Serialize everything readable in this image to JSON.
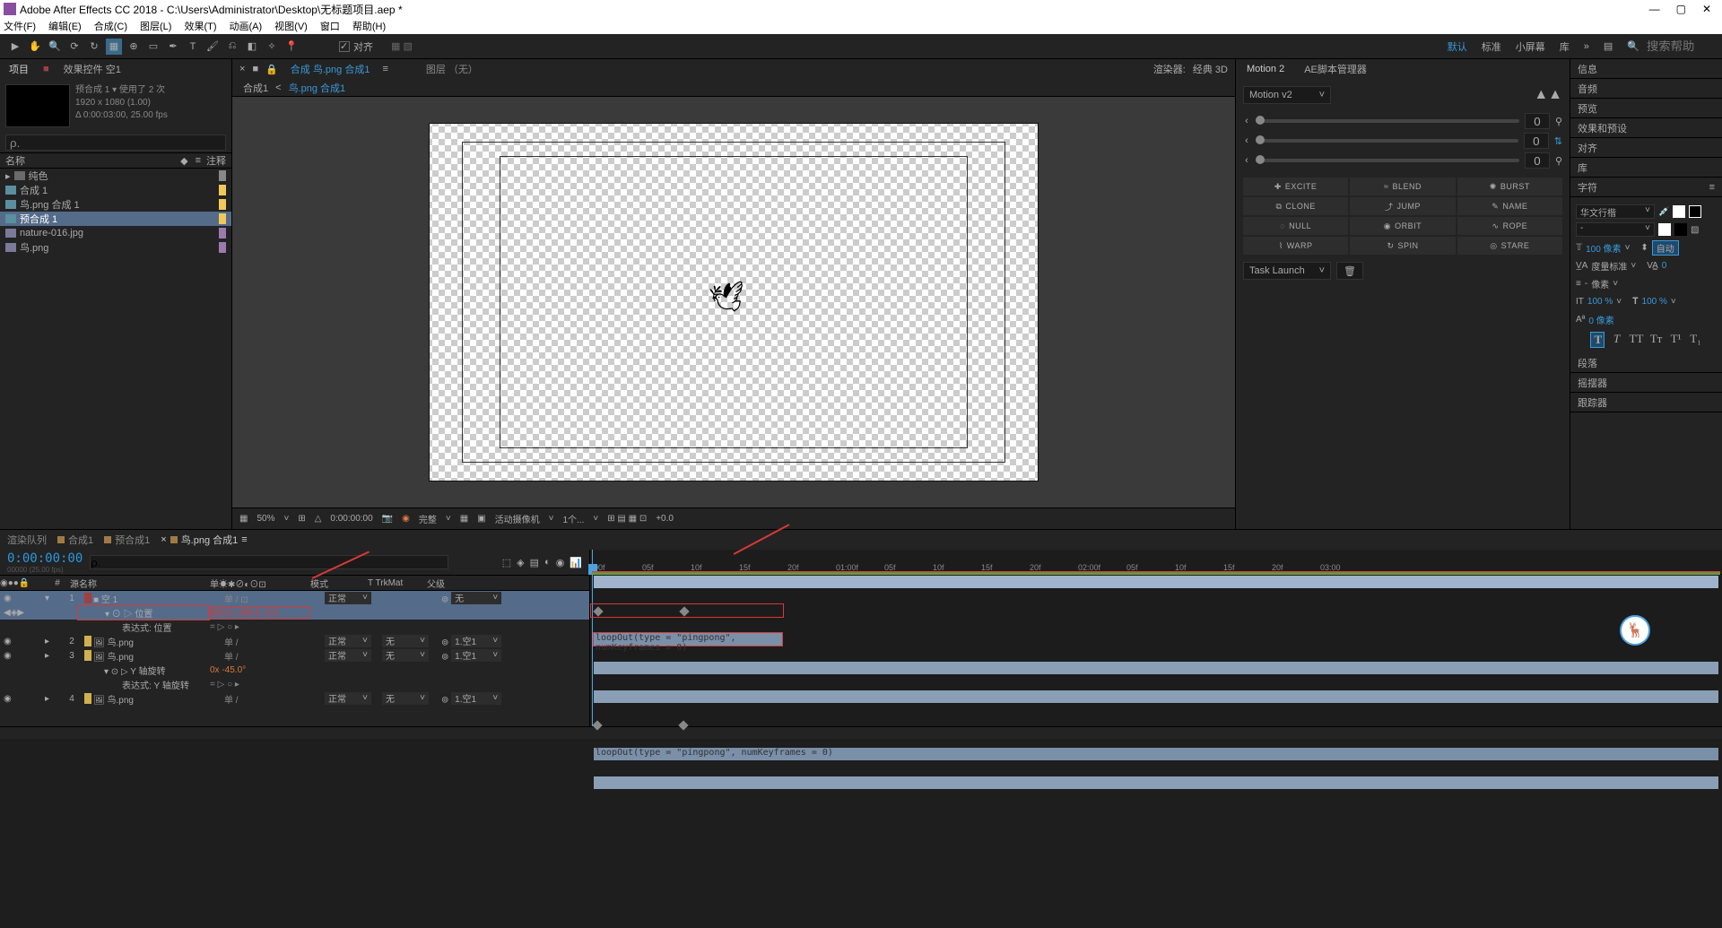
{
  "titlebar": {
    "icon_label": "Ae",
    "title": "Adobe After Effects CC 2018 - C:\\Users\\Administrator\\Desktop\\无标题项目.aep *"
  },
  "menubar": [
    "文件(F)",
    "编辑(E)",
    "合成(C)",
    "图层(L)",
    "效果(T)",
    "动画(A)",
    "视图(V)",
    "窗口",
    "帮助(H)"
  ],
  "toolbar": {
    "snap_label": "对齐",
    "workspaces": [
      "默认",
      "标准",
      "小屏幕",
      "库"
    ],
    "search_placeholder": "搜索帮助"
  },
  "project_panel": {
    "tabs": [
      "项目",
      "效果控件 空1"
    ],
    "comp": {
      "name": "预合成 1",
      "used": "使用了 2 次",
      "dims": "1920 x 1080 (1.00)",
      "duration": "Δ 0:00:03:00, 25.00 fps"
    },
    "search": "ρ.",
    "columns": {
      "name": "名称",
      "note": "注释"
    },
    "items": [
      {
        "type": "folder",
        "label": "纯色"
      },
      {
        "type": "comp",
        "label": "合成 1"
      },
      {
        "type": "comp",
        "label": "鸟.png 合成 1"
      },
      {
        "type": "comp",
        "label": "预合成 1",
        "selected": true
      },
      {
        "type": "file",
        "label": "nature-016.jpg"
      },
      {
        "type": "file",
        "label": "鸟.png"
      }
    ]
  },
  "composition_panel": {
    "tabs": {
      "comp_tab": "合成 鸟.png 合成1",
      "layer_tab": "图层 （无）"
    },
    "breadcrumb": [
      "合成1",
      "鸟.png 合成1"
    ],
    "renderer_label": "渲染器:",
    "renderer_value": "经典 3D",
    "footer": {
      "zoom": "50%",
      "time": "0:00:00:00",
      "quality": "完整",
      "camera": "活动摄像机",
      "views": "1个...",
      "exposure": "+0.0"
    }
  },
  "motion_panel": {
    "tabs": [
      "Motion 2",
      "AE脚本管理器"
    ],
    "preset": "Motion v2",
    "sliders": [
      0,
      0,
      0
    ],
    "tools": [
      "EXCITE",
      "BLEND",
      "BURST",
      "CLONE",
      "JUMP",
      "NAME",
      "NULL",
      "ORBIT",
      "ROPE",
      "WARP",
      "SPIN",
      "STARE"
    ],
    "task_launch": "Task Launch"
  },
  "right_stack": {
    "items": [
      "信息",
      "音频",
      "预览",
      "效果和预设",
      "对齐",
      "库",
      "字符",
      "段落",
      "摇摆器",
      "跟踪器"
    ]
  },
  "char_panel": {
    "font": "华文行楷",
    "style": "-",
    "size": "100 像素",
    "leading": "自动",
    "kerning": "度量标准",
    "tracking": "0",
    "fill_label": "像素",
    "scale_v": "100 %",
    "scale_h": "100 %",
    "baseline": "0 像素",
    "styles": [
      "T",
      "T",
      "TT",
      "Tr",
      "T¹",
      "T₁"
    ]
  },
  "timeline": {
    "tabs": [
      "渲染队列",
      "合成1",
      "预合成1",
      "鸟.png 合成1"
    ],
    "active_tab": 3,
    "timecode": "0:00:00:00",
    "timecode_sub": "00000 (25.00 fps)",
    "columns": {
      "src": "源名称",
      "mode": "模式",
      "trkmat": "T TrkMat",
      "parent": "父级"
    },
    "ruler": [
      "00f",
      "05f",
      "10f",
      "15f",
      "20f",
      "01:00f",
      "05f",
      "10f",
      "15f",
      "20f",
      "02:00f",
      "05f",
      "10f",
      "15f",
      "20f",
      "03:00"
    ],
    "layers": [
      {
        "num": 1,
        "color": "#a04040",
        "name": "空 1",
        "switches": "单 /",
        "mode": "正常",
        "trk": "",
        "parent": "无",
        "selected": true
      },
      {
        "prop": true,
        "name": "位置",
        "value": "960.0, 496.0, 0.0",
        "selected": true,
        "redbox": true
      },
      {
        "expr_row": true,
        "name": "表达式: 位置",
        "switches": "= ▷ ○ ▸"
      },
      {
        "num": 2,
        "color": "#d0b050",
        "name": "鸟.png",
        "switches": "单 /",
        "mode": "正常",
        "trk": "无",
        "parent": "1.空1"
      },
      {
        "num": 3,
        "color": "#d0b050",
        "name": "鸟.png",
        "switches": "单 /",
        "mode": "正常",
        "trk": "无",
        "parent": "1.空1"
      },
      {
        "prop": true,
        "name": "Y 轴旋转",
        "value": "0x -45.0°"
      },
      {
        "expr_row": true,
        "name": "表达式: Y 轴旋转",
        "switches": "= ▷ ○ ▸"
      },
      {
        "num": 4,
        "color": "#d0b050",
        "name": "鸟.png",
        "switches": "单 /",
        "mode": "正常",
        "trk": "无",
        "parent": "1.空1"
      }
    ],
    "expression": "loopOut(type = \"pingpong\", numKeyframes = 0)"
  }
}
